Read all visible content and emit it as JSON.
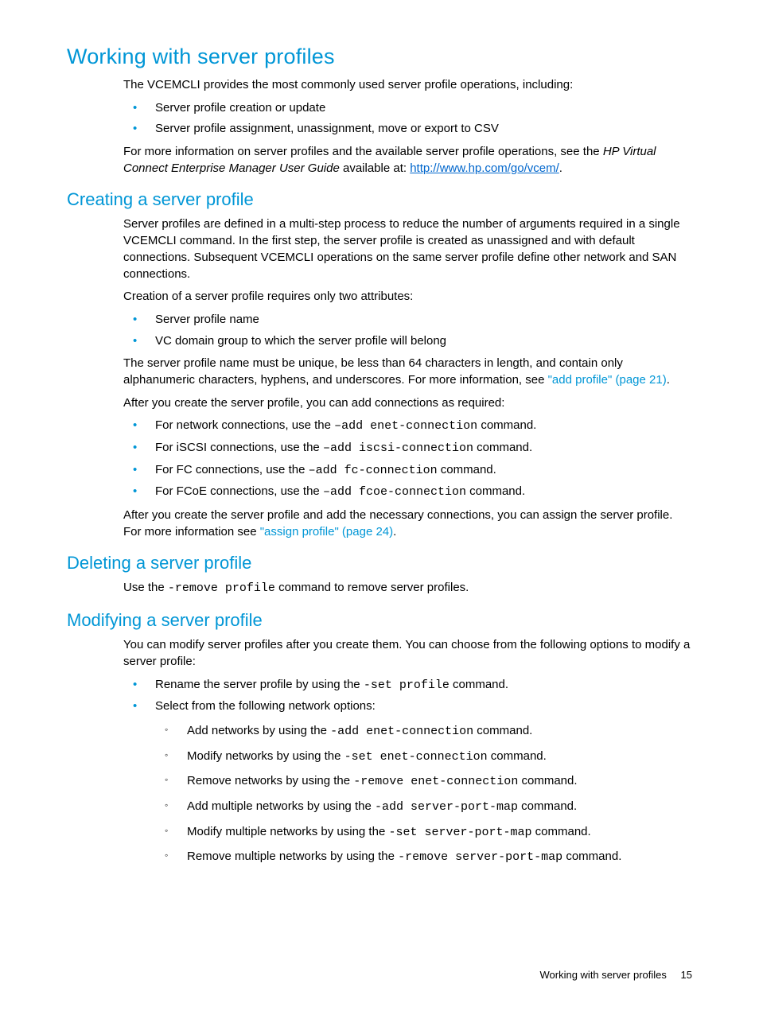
{
  "h1": "Working with server profiles",
  "intro": "The VCEMCLI provides the most commonly used server profile operations, including:",
  "intro_bullets": [
    "Server profile creation or update",
    "Server profile assignment, unassignment, move or export to CSV"
  ],
  "moreinfo_prefix": "For more information on server profiles and the available server profile operations, see the ",
  "moreinfo_title": "HP Virtual Connect Enterprise Manager User Guide",
  "moreinfo_avail": " available at: ",
  "moreinfo_link": "http://www.hp.com/go/vcem/",
  "moreinfo_suffix": ".",
  "creating": {
    "heading": "Creating a server profile",
    "p1": "Server profiles are defined in a multi-step process to reduce the number of arguments required in a single VCEMCLI command. In the first step, the server profile is created as unassigned and with default connections. Subsequent VCEMCLI operations on the same server profile define other network and SAN connections.",
    "p2": "Creation of a server profile requires only two attributes:",
    "attrs": [
      "Server profile name",
      "VC domain group to which the server profile will belong"
    ],
    "name_rule_prefix": "The server profile name must be unique, be less than 64 characters in length, and contain only alphanumeric characters, hyphens, and underscores. For more information, see ",
    "name_rule_xref": "\"add profile\" (page 21)",
    "name_rule_suffix": ".",
    "after_create": "After you create the server profile, you can add connections as required:",
    "conn_items": [
      {
        "pre": "For network connections, use the ",
        "cmd": "–add enet-connection",
        "post": " command."
      },
      {
        "pre": "For iSCSI connections, use the ",
        "cmd": "–add iscsi-connection",
        "post": " command."
      },
      {
        "pre": "For FC connections, use the ",
        "cmd": "–add fc-connection",
        "post": " command."
      },
      {
        "pre": "For FCoE connections, use the ",
        "cmd": "–add fcoe-connection",
        "post": " command."
      }
    ],
    "assign_prefix": "After you create the server profile and add the necessary connections, you can assign the server profile. For more information see ",
    "assign_xref": "\"assign profile\" (page 24)",
    "assign_suffix": "."
  },
  "deleting": {
    "heading": "Deleting a server profile",
    "pre": "Use the ",
    "cmd": "-remove profile",
    "post": " command to remove server profiles."
  },
  "modifying": {
    "heading": "Modifying a server profile",
    "intro": "You can modify server profiles after you create them. You can choose from the following options to modify a server profile:",
    "rename_pre": "Rename the server profile by using the ",
    "rename_cmd": "-set profile",
    "rename_post": " command.",
    "net_options_label": "Select from the following network options:",
    "net_subs": [
      {
        "pre": "Add networks by using the ",
        "cmd": "-add enet-connection",
        "post": " command."
      },
      {
        "pre": "Modify networks by using the ",
        "cmd": "-set enet-connection",
        "post": " command."
      },
      {
        "pre": "Remove networks by using the ",
        "cmd": "-remove enet-connection",
        "post": " command."
      },
      {
        "pre": "Add multiple networks by using the ",
        "cmd": "-add server-port-map",
        "post": " command."
      },
      {
        "pre": "Modify multiple networks by using the ",
        "cmd": "-set server-port-map",
        "post": " command."
      },
      {
        "pre": "Remove multiple networks by using the ",
        "cmd": "-remove server-port-map",
        "post": " command."
      }
    ]
  },
  "footer": {
    "section": "Working with server profiles",
    "page": "15"
  }
}
